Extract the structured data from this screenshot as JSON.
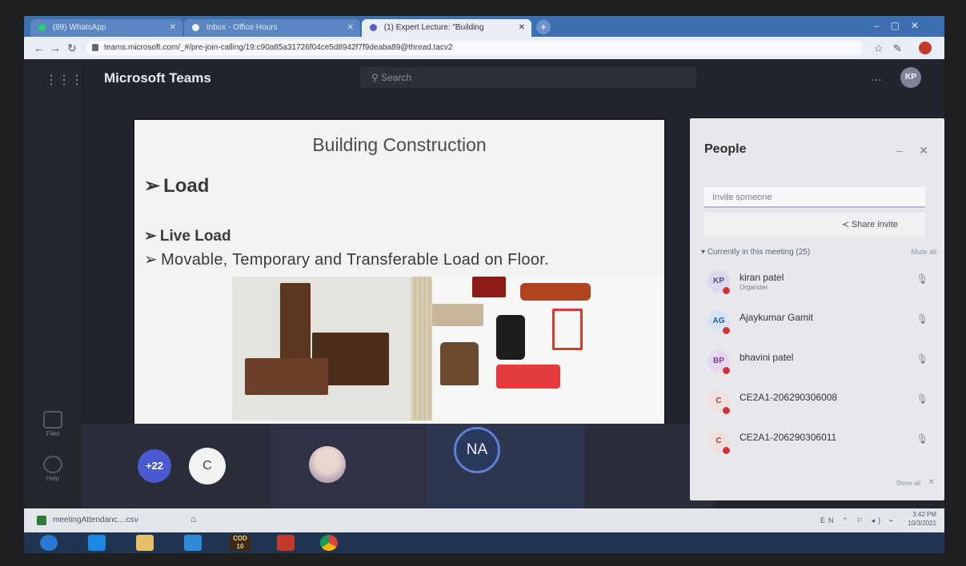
{
  "browser": {
    "tabs": [
      {
        "label": "(89) WhatsApp"
      },
      {
        "label": "Inbox - Office Hours"
      },
      {
        "label": "(1) Expert Lecture: \"Building"
      }
    ],
    "url": "teams.microsoft.com/_#/pre-join-calling/19:c90a85a31726f04ce5d8942f7f9deaba89@thread.tacv2"
  },
  "teams": {
    "brand": "Microsoft Teams",
    "search_placeholder": "Search",
    "me_initials": "KP",
    "rail": {
      "files": "Files",
      "help": "Help"
    }
  },
  "slide": {
    "title": "Building Construction",
    "bullets": [
      {
        "arrow": "➢",
        "text": "Load"
      },
      {
        "arrow": "➢",
        "text": "Live Load"
      },
      {
        "arrow": "➢",
        "text": "Movable, Temporary and Transferable Load on Floor."
      }
    ]
  },
  "participants_strip": {
    "overflow_count": "+22",
    "avatar_c": "C",
    "avatar_na": "NA"
  },
  "people": {
    "title": "People",
    "invite_placeholder": "Invite someone",
    "share_invite": "Share invite",
    "section_label": "Currently in this meeting (25)",
    "mute_all": "Mute all",
    "show_all": "Show all",
    "list": [
      {
        "initials": "KP",
        "name": "kiran patel",
        "role": "Organizer"
      },
      {
        "initials": "AG",
        "name": "Ajaykumar Gamit",
        "role": ""
      },
      {
        "initials": "BP",
        "name": "bhavini patel",
        "role": ""
      },
      {
        "initials": "C",
        "name": "CE2A1-206290306008",
        "role": ""
      },
      {
        "initials": "C",
        "name": "CE2A1-206290306011",
        "role": ""
      }
    ]
  },
  "downloads": {
    "file": "meetingAttendanc....csv"
  },
  "taskbar": {
    "cod_label": "COD",
    "cod_sub": "10",
    "clock_time": "3:42 PM",
    "clock_date": "10/3/2021"
  },
  "colors": {
    "teams_bg": "#23252e",
    "accent": "#4a5bd1",
    "presence_busy": "#d13438",
    "chrome_tab": "#3d6fb0"
  }
}
